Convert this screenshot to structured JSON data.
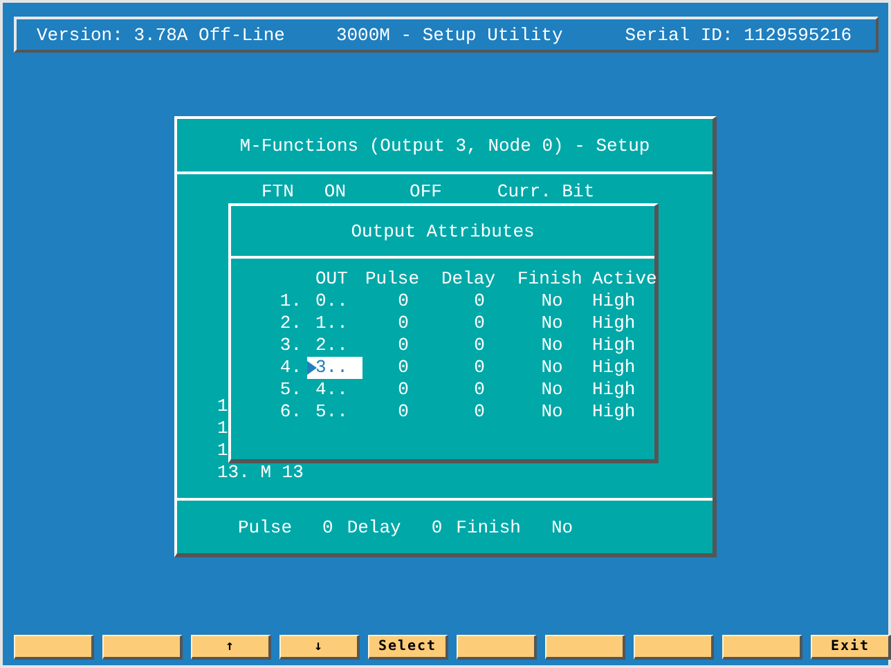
{
  "header": {
    "version": "Version: 3.78A Off-Line",
    "title": "3000M - Setup Utility",
    "serial": "Serial ID: 1129595216"
  },
  "dialog": {
    "title": "M-Functions (Output 3, Node 0) - Setup",
    "columns": [
      "FTN",
      "ON",
      "OFF",
      "Curr. Bit"
    ],
    "rows": [
      "1",
      "1",
      "1",
      "13. M 13"
    ],
    "footer": [
      {
        "label": "Pulse",
        "value": "0"
      },
      {
        "label": "Delay",
        "value": "0"
      },
      {
        "label": "Finish",
        "value": "No"
      }
    ]
  },
  "attributes": {
    "title": "Output Attributes",
    "columns": [
      "OUT",
      "Pulse",
      "Delay",
      "Finish",
      "Active"
    ],
    "rows": [
      {
        "index": "1.",
        "out": "0..",
        "pulse": "0",
        "delay": "0",
        "finish": "No",
        "active": "High",
        "selected": false
      },
      {
        "index": "2.",
        "out": "1..",
        "pulse": "0",
        "delay": "0",
        "finish": "No",
        "active": "High",
        "selected": false
      },
      {
        "index": "3.",
        "out": "2..",
        "pulse": "0",
        "delay": "0",
        "finish": "No",
        "active": "High",
        "selected": false
      },
      {
        "index": "4.",
        "out": "3..",
        "pulse": "0",
        "delay": "0",
        "finish": "No",
        "active": "High",
        "selected": true
      },
      {
        "index": "5.",
        "out": "4..",
        "pulse": "0",
        "delay": "0",
        "finish": "No",
        "active": "High",
        "selected": false
      },
      {
        "index": "6.",
        "out": "5..",
        "pulse": "0",
        "delay": "0",
        "finish": "No",
        "active": "High",
        "selected": false
      }
    ]
  },
  "function_keys": [
    {
      "kind": "blank"
    },
    {
      "kind": "blank"
    },
    {
      "kind": "key",
      "label": "↑"
    },
    {
      "kind": "key",
      "label": "↓"
    },
    {
      "kind": "key",
      "label": "Select"
    },
    {
      "kind": "blank"
    },
    {
      "kind": "blank"
    },
    {
      "kind": "blank"
    },
    {
      "kind": "blank"
    },
    {
      "kind": "key",
      "label": "Exit"
    }
  ]
}
